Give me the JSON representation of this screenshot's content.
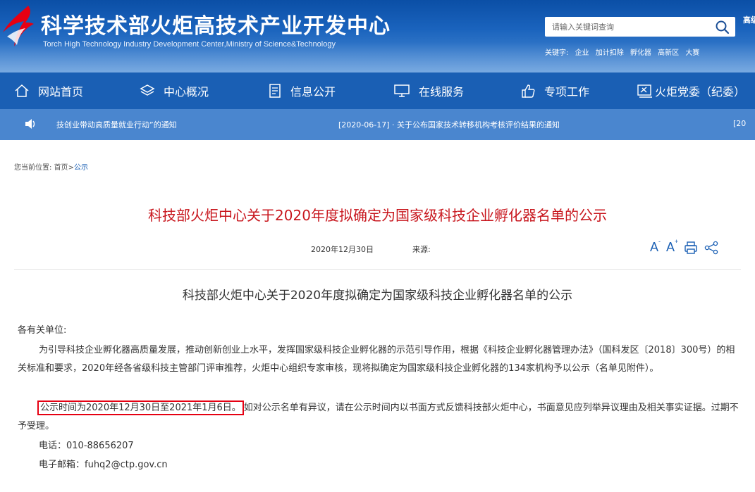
{
  "header": {
    "title": "科学技术部火炬高技术产业开发中心",
    "subtitle": "Torch High Technology Industry Development Center,Ministry of Science&Technology",
    "search_placeholder": "请输入关键词查询",
    "advanced_search": "高级搜索",
    "keywords_label": "关键字:",
    "keywords": [
      "企业",
      "加计扣除",
      "孵化器",
      "高新区",
      "大赛"
    ]
  },
  "nav": {
    "items": [
      {
        "label": "网站首页",
        "icon": "home-icon"
      },
      {
        "label": "中心概况",
        "icon": "layers-icon"
      },
      {
        "label": "信息公开",
        "icon": "document-icon"
      },
      {
        "label": "在线服务",
        "icon": "monitor-icon"
      },
      {
        "label": "专项工作",
        "icon": "thumbs-up-icon"
      },
      {
        "label": "火炬党委（纪委）",
        "icon": "party-icon"
      }
    ]
  },
  "ticker": {
    "items": [
      "技创业带动高质量就业行动”的通知",
      "[2020-06-17] · 关于公布国家技术转移机构考核评价结果的通知",
      "[20"
    ]
  },
  "breadcrumb": {
    "label": "您当前位置:",
    "home": "首页",
    "sep": ">",
    "current": "公示"
  },
  "article": {
    "title": "科技部火炬中心关于2020年度拟确定为国家级科技企业孵化器名单的公示",
    "date": "2020年12月30日",
    "source_label": "来源:",
    "doc_title": "科技部火炬中心关于2020年度拟确定为国家级科技企业孵化器名单的公示",
    "salutation": "各有关单位:",
    "paragraph": "为引导科技企业孵化器高质量发展，推动创新创业上水平，发挥国家级科技企业孵化器的示范引导作用，根据《科技企业孵化器管理办法》（国科发区〔2018〕300号）的相关标准和要求，2020年经各省级科技主管部门评审推荐，火炬中心组织专家审核，现将拟确定为国家级科技企业孵化器的134家机构予以公示（名单见附件）。",
    "notice_highlight": "公示时间为2020年12月30日至2021年1月6日。",
    "notice_rest": "如对公示名单有异议，请在公示时间内以书面方式反馈科技部火炬中心，书面意见应列举异议理由及相关事实证据。过期不予受理。",
    "phone": "电话：010-88656207",
    "email": "电子邮箱：fuhq2@ctp.gov.cn"
  },
  "colors": {
    "header_blue": "#1a5fb4",
    "title_red": "#c8161d",
    "highlight_red": "#e60012"
  }
}
